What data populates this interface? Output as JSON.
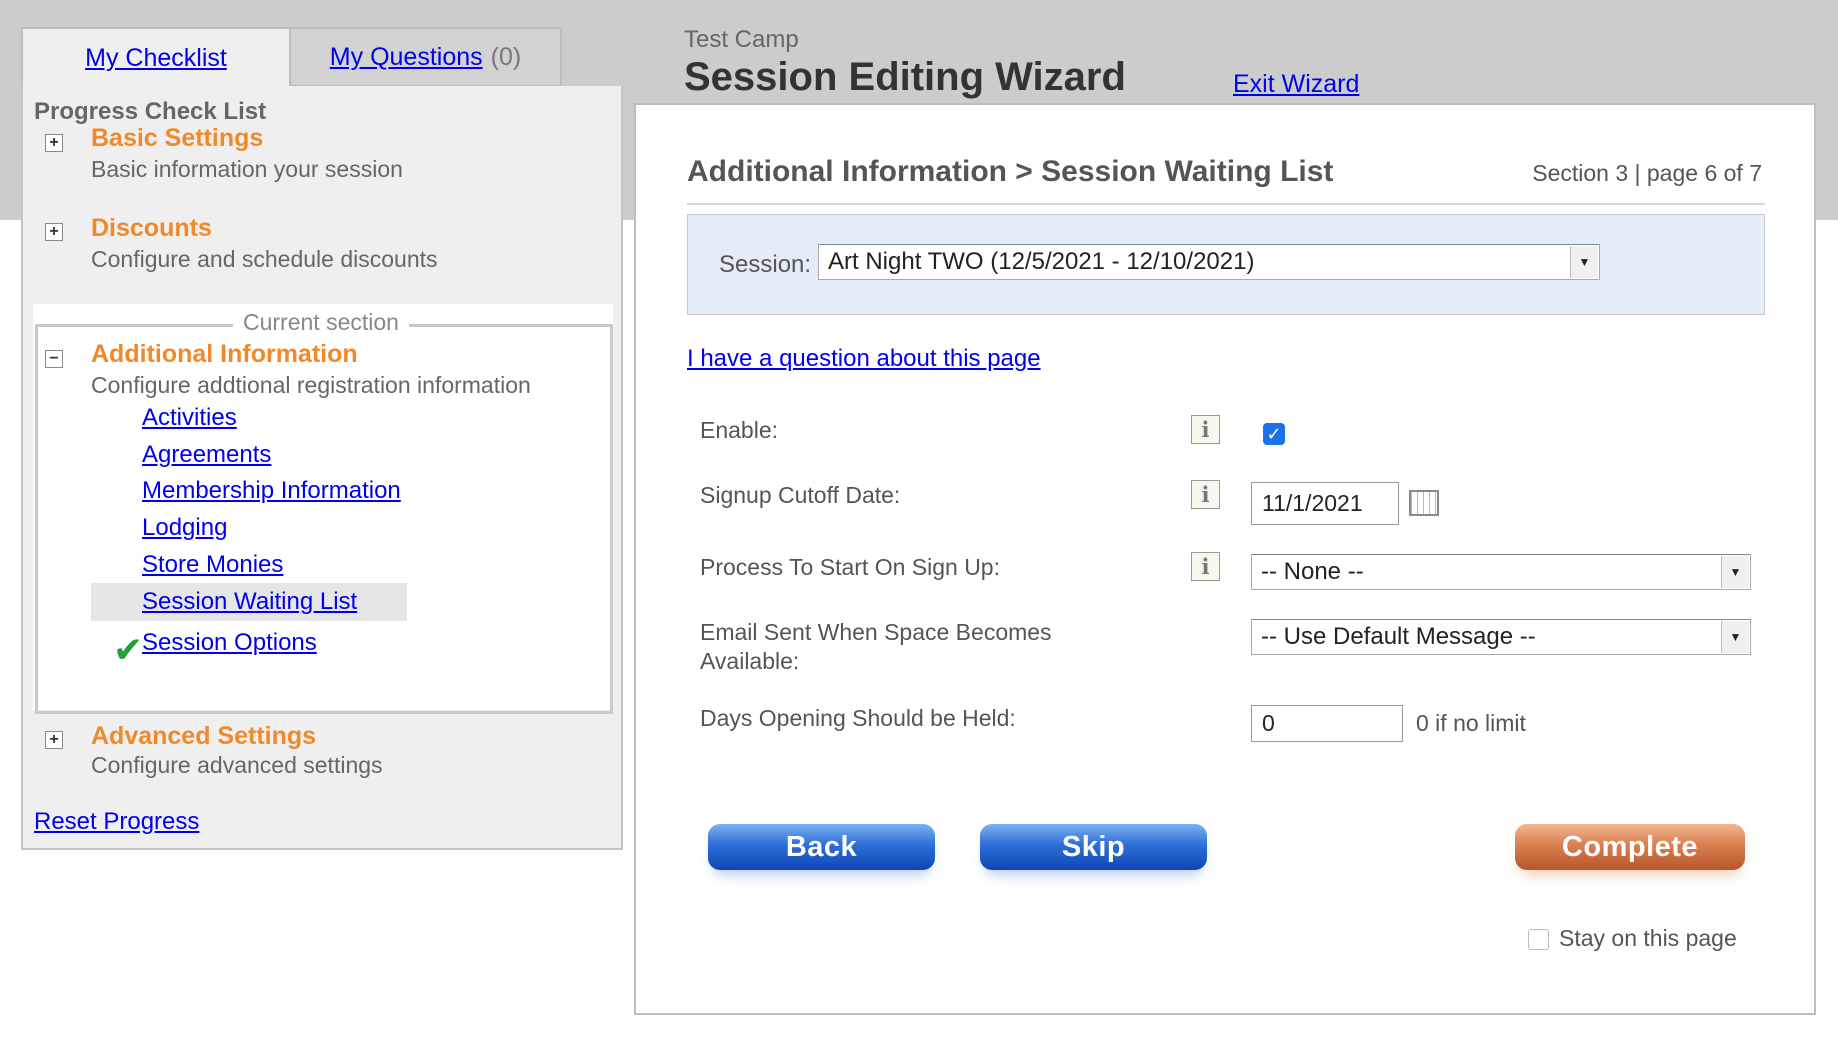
{
  "tabs": {
    "checklist_label": "My Checklist",
    "questions_label": "My Questions",
    "questions_count": "(0)"
  },
  "sidebar": {
    "title": "Progress Check List",
    "steps": [
      {
        "title": "Basic Settings",
        "desc": "Basic information your session",
        "toggle": "+"
      },
      {
        "title": "Discounts",
        "desc": "Configure and schedule discounts",
        "toggle": "+"
      },
      {
        "title": "Additional Information",
        "desc": "Configure addtional registration information",
        "toggle": "−"
      },
      {
        "title": "Advanced Settings",
        "desc": "Configure advanced settings",
        "toggle": "+"
      }
    ],
    "current_section_label": "Current section",
    "subitems": [
      "Activities",
      "Agreements",
      "Membership Information",
      "Lodging",
      "Store Monies",
      "Session Waiting List",
      "Session Options"
    ],
    "checkmark": "✔",
    "reset_label": "Reset Progress"
  },
  "header": {
    "camp": "Test Camp",
    "title": "Session Editing Wizard",
    "exit_label": "Exit Wizard"
  },
  "main": {
    "section_title": "Additional Information > Session Waiting List",
    "section_page": "Section 3 | page 6 of 7",
    "session_label": "Session:",
    "session_value": "Art Night TWO (12/5/2021 - 12/10/2021)",
    "question_link": "I have a question about this page",
    "fields": {
      "enable_label": "Enable:",
      "enable_checked": true,
      "cutoff_label": "Signup Cutoff Date:",
      "cutoff_value": "11/1/2021",
      "process_label": "Process To Start On Sign Up:",
      "process_value": "-- None --",
      "email_label": "Email Sent When Space Becomes Available:",
      "email_value": "-- Use Default Message --",
      "days_label": "Days Opening Should be Held:",
      "days_value": "0",
      "days_hint": "0 if no limit"
    },
    "info_glyph": "i",
    "buttons": {
      "back": "Back",
      "skip": "Skip",
      "complete": "Complete"
    },
    "stay_label": "Stay on this page",
    "stay_checked": false
  },
  "colors": {
    "accent_orange": "#f0892a",
    "link_blue": "#0000ee",
    "session_box_bg": "#e3ecf8",
    "button_blue": "#2e6fd8",
    "button_orange": "#d98050"
  }
}
